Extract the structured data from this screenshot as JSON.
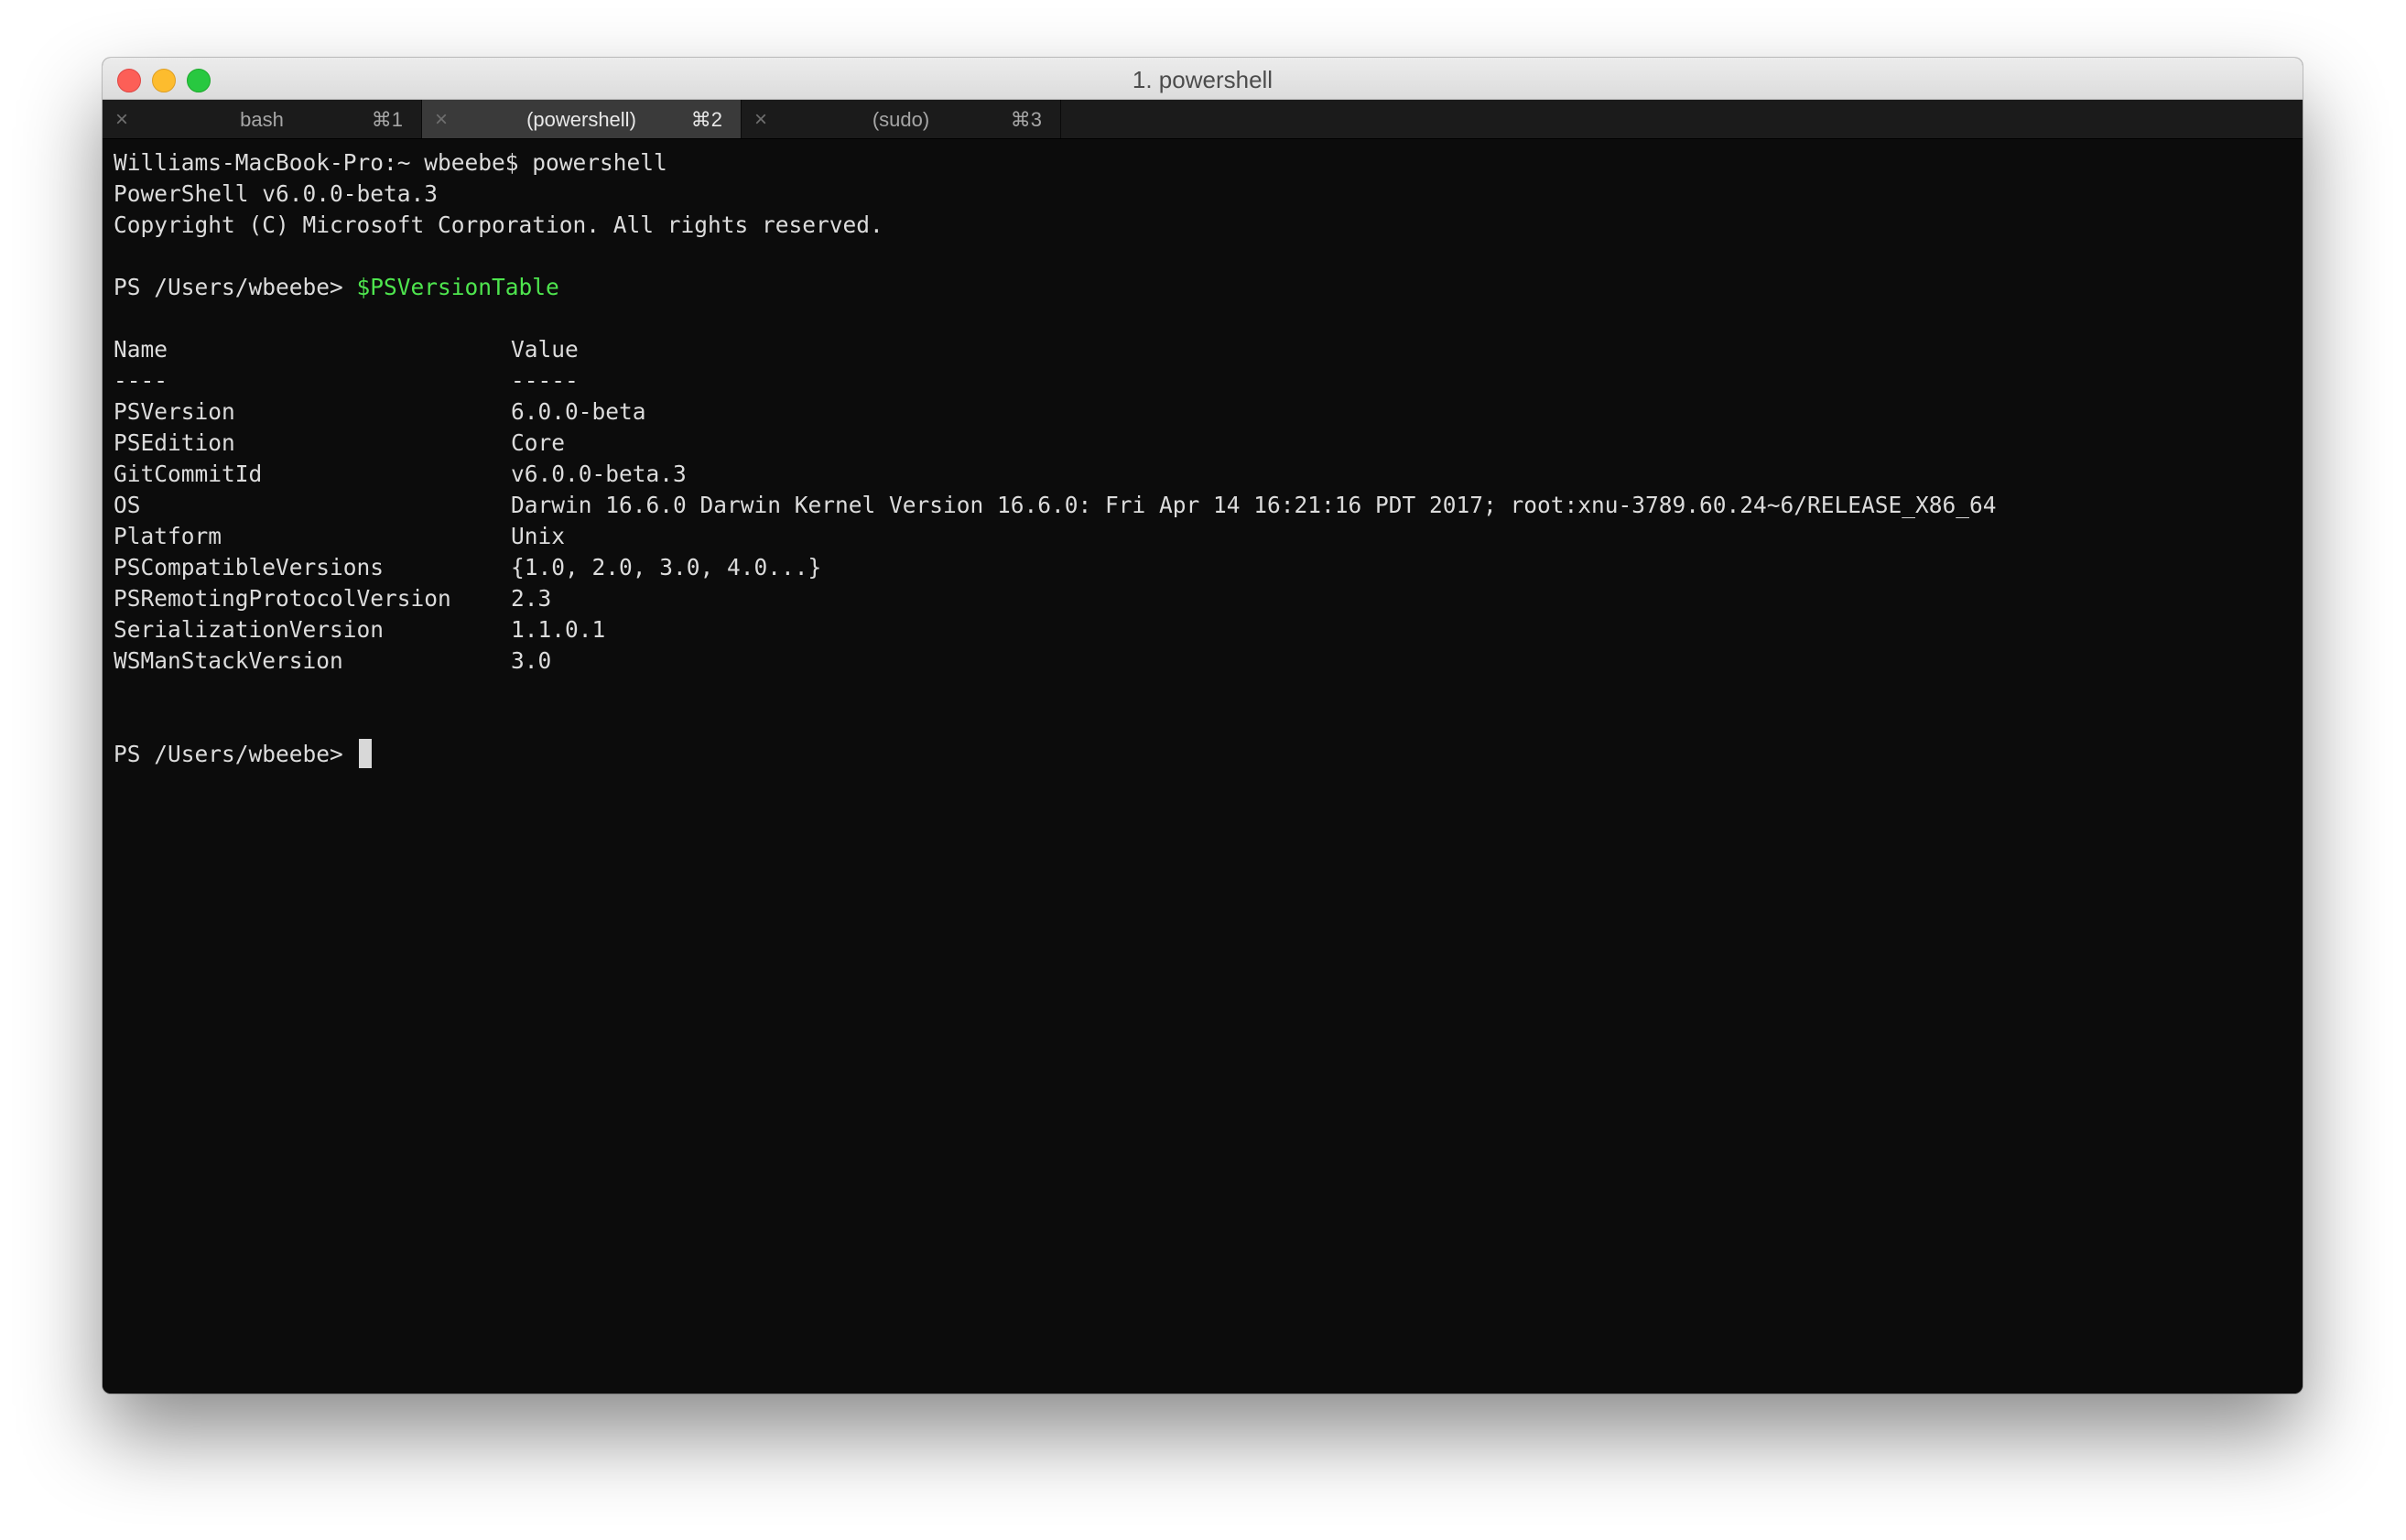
{
  "window": {
    "title": "1. powershell"
  },
  "tabs": [
    {
      "close": "×",
      "label": "bash",
      "shortcut": "⌘1"
    },
    {
      "close": "×",
      "label": "(powershell)",
      "shortcut": "⌘2"
    },
    {
      "close": "×",
      "label": "(sudo)",
      "shortcut": "⌘3"
    }
  ],
  "terminal": {
    "intro": [
      "Williams-MacBook-Pro:~ wbeebe$ powershell",
      "PowerShell v6.0.0-beta.3",
      "Copyright (C) Microsoft Corporation. All rights reserved."
    ],
    "prompt1": "PS /Users/wbeebe> ",
    "command1": "$PSVersionTable",
    "table": {
      "header": {
        "name": "Name",
        "value": "Value"
      },
      "divider": {
        "name": "----",
        "value": "-----"
      },
      "rows": [
        {
          "name": "PSVersion",
          "value": "6.0.0-beta"
        },
        {
          "name": "PSEdition",
          "value": "Core"
        },
        {
          "name": "GitCommitId",
          "value": "v6.0.0-beta.3"
        },
        {
          "name": "OS",
          "value": "Darwin 16.6.0 Darwin Kernel Version 16.6.0: Fri Apr 14 16:21:16 PDT 2017; root:xnu-3789.60.24~6/RELEASE_X86_64"
        },
        {
          "name": "Platform",
          "value": "Unix"
        },
        {
          "name": "PSCompatibleVersions",
          "value": "{1.0, 2.0, 3.0, 4.0...}"
        },
        {
          "name": "PSRemotingProtocolVersion",
          "value": "2.3"
        },
        {
          "name": "SerializationVersion",
          "value": "1.1.0.1"
        },
        {
          "name": "WSManStackVersion",
          "value": "3.0"
        }
      ]
    },
    "prompt2": "PS /Users/wbeebe> "
  },
  "colors": {
    "terminal_bg": "#0c0c0c",
    "terminal_fg": "#dcdcdc",
    "command_green": "#4ee54e",
    "active_tab": "#3a3a3a",
    "tabbar": "#1b1b1b"
  }
}
